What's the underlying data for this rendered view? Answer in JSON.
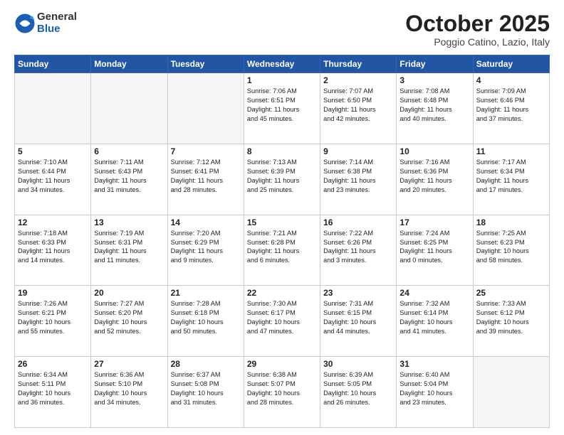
{
  "logo": {
    "general": "General",
    "blue": "Blue"
  },
  "title": "October 2025",
  "location": "Poggio Catino, Lazio, Italy",
  "weekdays": [
    "Sunday",
    "Monday",
    "Tuesday",
    "Wednesday",
    "Thursday",
    "Friday",
    "Saturday"
  ],
  "weeks": [
    [
      {
        "day": "",
        "text": ""
      },
      {
        "day": "",
        "text": ""
      },
      {
        "day": "",
        "text": ""
      },
      {
        "day": "1",
        "text": "Sunrise: 7:06 AM\nSunset: 6:51 PM\nDaylight: 11 hours\nand 45 minutes."
      },
      {
        "day": "2",
        "text": "Sunrise: 7:07 AM\nSunset: 6:50 PM\nDaylight: 11 hours\nand 42 minutes."
      },
      {
        "day": "3",
        "text": "Sunrise: 7:08 AM\nSunset: 6:48 PM\nDaylight: 11 hours\nand 40 minutes."
      },
      {
        "day": "4",
        "text": "Sunrise: 7:09 AM\nSunset: 6:46 PM\nDaylight: 11 hours\nand 37 minutes."
      }
    ],
    [
      {
        "day": "5",
        "text": "Sunrise: 7:10 AM\nSunset: 6:44 PM\nDaylight: 11 hours\nand 34 minutes."
      },
      {
        "day": "6",
        "text": "Sunrise: 7:11 AM\nSunset: 6:43 PM\nDaylight: 11 hours\nand 31 minutes."
      },
      {
        "day": "7",
        "text": "Sunrise: 7:12 AM\nSunset: 6:41 PM\nDaylight: 11 hours\nand 28 minutes."
      },
      {
        "day": "8",
        "text": "Sunrise: 7:13 AM\nSunset: 6:39 PM\nDaylight: 11 hours\nand 25 minutes."
      },
      {
        "day": "9",
        "text": "Sunrise: 7:14 AM\nSunset: 6:38 PM\nDaylight: 11 hours\nand 23 minutes."
      },
      {
        "day": "10",
        "text": "Sunrise: 7:16 AM\nSunset: 6:36 PM\nDaylight: 11 hours\nand 20 minutes."
      },
      {
        "day": "11",
        "text": "Sunrise: 7:17 AM\nSunset: 6:34 PM\nDaylight: 11 hours\nand 17 minutes."
      }
    ],
    [
      {
        "day": "12",
        "text": "Sunrise: 7:18 AM\nSunset: 6:33 PM\nDaylight: 11 hours\nand 14 minutes."
      },
      {
        "day": "13",
        "text": "Sunrise: 7:19 AM\nSunset: 6:31 PM\nDaylight: 11 hours\nand 11 minutes."
      },
      {
        "day": "14",
        "text": "Sunrise: 7:20 AM\nSunset: 6:29 PM\nDaylight: 11 hours\nand 9 minutes."
      },
      {
        "day": "15",
        "text": "Sunrise: 7:21 AM\nSunset: 6:28 PM\nDaylight: 11 hours\nand 6 minutes."
      },
      {
        "day": "16",
        "text": "Sunrise: 7:22 AM\nSunset: 6:26 PM\nDaylight: 11 hours\nand 3 minutes."
      },
      {
        "day": "17",
        "text": "Sunrise: 7:24 AM\nSunset: 6:25 PM\nDaylight: 11 hours\nand 0 minutes."
      },
      {
        "day": "18",
        "text": "Sunrise: 7:25 AM\nSunset: 6:23 PM\nDaylight: 10 hours\nand 58 minutes."
      }
    ],
    [
      {
        "day": "19",
        "text": "Sunrise: 7:26 AM\nSunset: 6:21 PM\nDaylight: 10 hours\nand 55 minutes."
      },
      {
        "day": "20",
        "text": "Sunrise: 7:27 AM\nSunset: 6:20 PM\nDaylight: 10 hours\nand 52 minutes."
      },
      {
        "day": "21",
        "text": "Sunrise: 7:28 AM\nSunset: 6:18 PM\nDaylight: 10 hours\nand 50 minutes."
      },
      {
        "day": "22",
        "text": "Sunrise: 7:30 AM\nSunset: 6:17 PM\nDaylight: 10 hours\nand 47 minutes."
      },
      {
        "day": "23",
        "text": "Sunrise: 7:31 AM\nSunset: 6:15 PM\nDaylight: 10 hours\nand 44 minutes."
      },
      {
        "day": "24",
        "text": "Sunrise: 7:32 AM\nSunset: 6:14 PM\nDaylight: 10 hours\nand 41 minutes."
      },
      {
        "day": "25",
        "text": "Sunrise: 7:33 AM\nSunset: 6:12 PM\nDaylight: 10 hours\nand 39 minutes."
      }
    ],
    [
      {
        "day": "26",
        "text": "Sunrise: 6:34 AM\nSunset: 5:11 PM\nDaylight: 10 hours\nand 36 minutes."
      },
      {
        "day": "27",
        "text": "Sunrise: 6:36 AM\nSunset: 5:10 PM\nDaylight: 10 hours\nand 34 minutes."
      },
      {
        "day": "28",
        "text": "Sunrise: 6:37 AM\nSunset: 5:08 PM\nDaylight: 10 hours\nand 31 minutes."
      },
      {
        "day": "29",
        "text": "Sunrise: 6:38 AM\nSunset: 5:07 PM\nDaylight: 10 hours\nand 28 minutes."
      },
      {
        "day": "30",
        "text": "Sunrise: 6:39 AM\nSunset: 5:05 PM\nDaylight: 10 hours\nand 26 minutes."
      },
      {
        "day": "31",
        "text": "Sunrise: 6:40 AM\nSunset: 5:04 PM\nDaylight: 10 hours\nand 23 minutes."
      },
      {
        "day": "",
        "text": ""
      }
    ]
  ]
}
